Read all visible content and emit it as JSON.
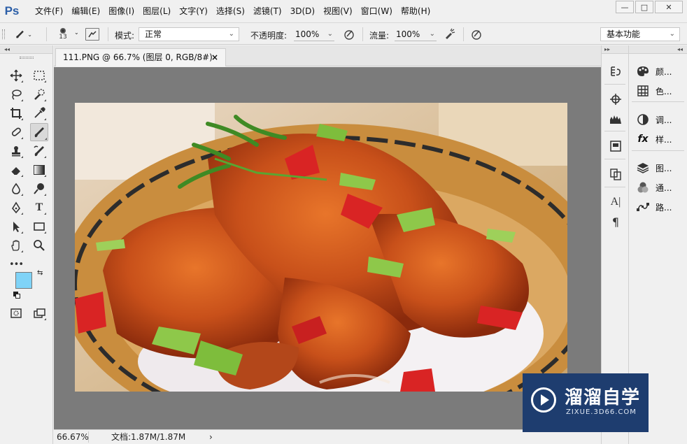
{
  "app": {
    "logo": "Ps"
  },
  "menus": [
    "文件(F)",
    "编辑(E)",
    "图像(I)",
    "图层(L)",
    "文字(Y)",
    "选择(S)",
    "滤镜(T)",
    "3D(D)",
    "视图(V)",
    "窗口(W)",
    "帮助(H)"
  ],
  "window_controls": {
    "minimize": "—",
    "maximize": "□",
    "close": "✕"
  },
  "options": {
    "brush_size": "13",
    "mode_label": "模式:",
    "mode_value": "正常",
    "opacity_label": "不透明度:",
    "opacity_value": "100%",
    "flow_label": "流量:",
    "flow_value": "100%",
    "workspace": "基本功能"
  },
  "panel_collapse": "◂◂",
  "panel_expand": "▸▸",
  "document": {
    "tab_title": "111.PNG @ 66.7% (图层 0, RGB/8#)",
    "tab_close": "×"
  },
  "colors": {
    "foreground": "#7fd3f7",
    "background": "#ffffff",
    "canvas_bg": "#7b7b7b",
    "watermark_bg": "#1e3d6f"
  },
  "tools": [
    "move-tool",
    "marquee-tool",
    "lasso-tool",
    "quick-select-tool",
    "crop-tool",
    "eyedropper-tool",
    "healing-tool",
    "brush-tool",
    "stamp-tool",
    "history-brush-tool",
    "eraser-tool",
    "gradient-tool",
    "blur-tool",
    "dodge-tool",
    "pen-tool",
    "type-tool",
    "path-select-tool",
    "shape-tool",
    "hand-tool",
    "zoom-tool"
  ],
  "type_tool_glyph": "T",
  "more_tools": "•••",
  "status": {
    "zoom": "66.67%",
    "doc_info": "文档:1.87M/1.87M",
    "arrow": "›"
  },
  "right_panels": [
    {
      "icon": "palette-icon",
      "label": "颜..."
    },
    {
      "icon": "swatches-icon",
      "label": "色..."
    },
    {
      "icon": "adjustments-icon",
      "label": "调..."
    },
    {
      "icon": "styles-icon",
      "label": "样..."
    },
    {
      "icon": "layers-icon",
      "label": "图..."
    },
    {
      "icon": "channels-icon",
      "label": "通..."
    },
    {
      "icon": "paths-icon",
      "label": "路..."
    }
  ],
  "styles_glyph": "fx",
  "strip_text_glyphs": {
    "character": "A|",
    "paragraph": "¶"
  },
  "watermark": {
    "title": "溜溜自学",
    "url": "ZIXUE.3D66.COM"
  }
}
